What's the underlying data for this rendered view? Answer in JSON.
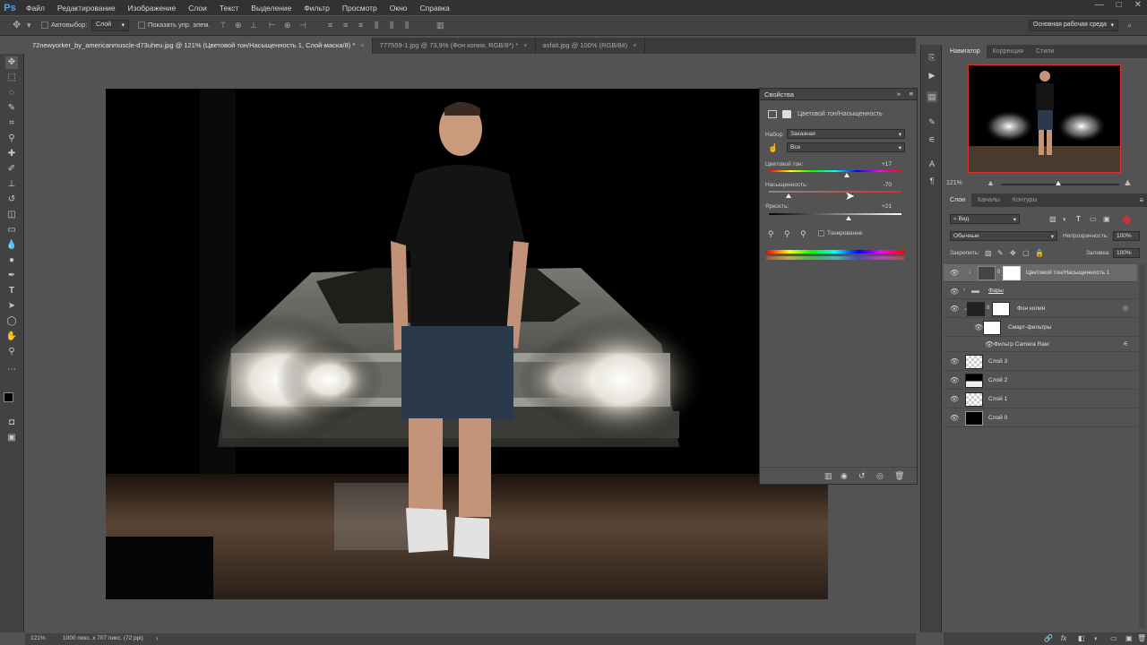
{
  "app": {
    "logo": "Ps"
  },
  "menu": [
    "Файл",
    "Редактирование",
    "Изображение",
    "Слои",
    "Текст",
    "Выделение",
    "Фильтр",
    "Просмотр",
    "Окно",
    "Справка"
  ],
  "window_controls": [
    "—",
    "□",
    "✕"
  ],
  "options": {
    "autoselect_label": "Автовыбор:",
    "autoselect_value": "Слой",
    "show_controls_label": "Показать упр. элем.",
    "workspace": "Основная рабочая среда"
  },
  "tabs": [
    {
      "label": "72newyorker_by_americanmuscle-d73uheu.jpg @ 121% (Цветовой тон/Насыщенность 1, Слой-маска/8) *",
      "close": "×"
    },
    {
      "label": "777559-1.jpg @ 73,9% (Фон копия, RGB/8*) *",
      "close": "×"
    },
    {
      "label": "asfalt.jpg @ 100% (RGB/8#)",
      "close": "×"
    }
  ],
  "properties": {
    "title": "Свойства",
    "subtitle": "Цветовой тон/Насыщенность",
    "preset_label": "Набор:",
    "preset_value": "Заказная",
    "channel_value": "Все",
    "hue_label": "Цветовой тон:",
    "hue_value": "+17",
    "hue_position": 0.59,
    "saturation_label": "Насыщенность:",
    "saturation_value": "-70",
    "saturation_position": 0.15,
    "lightness_label": "Яркость:",
    "lightness_value": "+21",
    "lightness_position": 0.6,
    "colorize_label": "Тонирование",
    "collapse_glyph": "»",
    "menu_glyph": "≡"
  },
  "navigator": {
    "tabs": [
      "Навигатор",
      "Коррекция",
      "Стили"
    ],
    "zoom": "121%"
  },
  "layers": {
    "tabs": [
      "Слои",
      "Каналы",
      "Контуры"
    ],
    "filter_value": "Вид",
    "blend_mode": "Обычные",
    "opacity_label": "Непрозрачность:",
    "opacity_value": "100%",
    "lock_label": "Закрепить:",
    "fill_label": "Заливка:",
    "fill_value": "100%",
    "items": [
      {
        "name": "Цветовой тон/Насыщенность 1"
      },
      {
        "name": "Фары"
      },
      {
        "name": "Фон копия"
      },
      {
        "name": "Смарт-фильтры"
      },
      {
        "name": "Фильтр Camera Raw"
      },
      {
        "name": "Слой 3"
      },
      {
        "name": "Слой 2"
      },
      {
        "name": "Слой 1"
      },
      {
        "name": "Слой 0"
      }
    ],
    "footer_icons": [
      "🔗",
      "fx",
      "◧",
      "◐",
      "▭",
      "▣",
      "🗑"
    ]
  },
  "status": {
    "zoom": "121%",
    "doc_info": "1000 пикс. x 707 пикс. (72 ppi)",
    "arrow": "›"
  },
  "colors": {
    "canvas_bg": "#000000",
    "panel_bg": "#535353",
    "dark_bar": "#323232",
    "accent_nav": "#e03030"
  }
}
